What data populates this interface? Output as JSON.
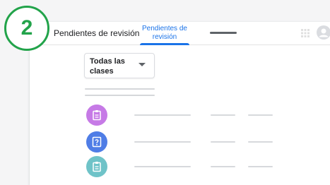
{
  "step_badge": {
    "number": "2",
    "color": "#22a34a"
  },
  "header": {
    "title": "Pendientes de revisión",
    "active_tab": {
      "label": "Pendientes de revisión"
    },
    "icons": [
      "apps-icon",
      "account-avatar-icon"
    ]
  },
  "filter": {
    "selected_label": "Todas las clases",
    "icon": "dropdown-arrow-icon"
  },
  "items": [
    {
      "icon": "assignment-icon",
      "color": "#c67ae6"
    },
    {
      "icon": "question-icon",
      "color": "#4f7de6"
    },
    {
      "icon": "material-icon",
      "color": "#6fc3c8"
    }
  ],
  "colors": {
    "accent": "#1a73e8"
  }
}
